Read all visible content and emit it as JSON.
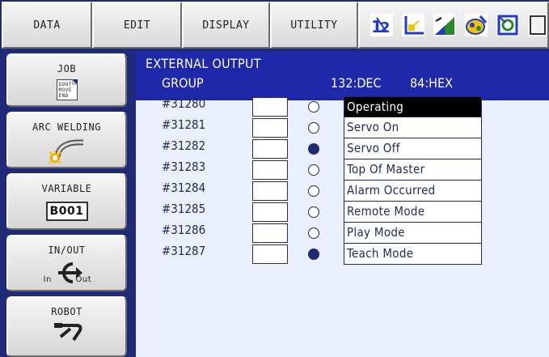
{
  "menu": {
    "items": [
      {
        "label": "DATA"
      },
      {
        "label": "EDIT"
      },
      {
        "label": "DISPLAY"
      },
      {
        "label": "UTILITY"
      }
    ],
    "status_icons": [
      "numeric-mode-icon",
      "coordinate-frame-icon",
      "speed-level-icon",
      "security-mode-icon",
      "play-mode-icon",
      "job-display-icon"
    ]
  },
  "sidebar": {
    "job_label": "JOB",
    "job_icon_text": "DOUT MOVE END",
    "arc_label": "ARC WELDING",
    "variable_label": "VARIABLE",
    "variable_value": "B001",
    "inout_label": "IN/OUT",
    "inout_in": "In",
    "inout_out": "Out",
    "robot_label": "ROBOT"
  },
  "panel": {
    "title": "EXTERNAL OUTPUT",
    "subtitle": "GROUP",
    "dec_label": "132:DEC",
    "hex_label": "84:HEX",
    "rows": [
      {
        "address": "#31280",
        "value": "",
        "state": "off",
        "name": "Operating",
        "selected": true
      },
      {
        "address": "#31281",
        "value": "",
        "state": "off",
        "name": "Servo On",
        "selected": false
      },
      {
        "address": "#31282",
        "value": "",
        "state": "on",
        "name": "Servo Off",
        "selected": false
      },
      {
        "address": "#31283",
        "value": "",
        "state": "off",
        "name": "Top Of Master",
        "selected": false
      },
      {
        "address": "#31284",
        "value": "",
        "state": "off",
        "name": "Alarm Occurred",
        "selected": false
      },
      {
        "address": "#31285",
        "value": "",
        "state": "off",
        "name": "Remote Mode",
        "selected": false
      },
      {
        "address": "#31286",
        "value": "",
        "state": "off",
        "name": "Play Mode",
        "selected": false
      },
      {
        "address": "#31287",
        "value": "",
        "state": "on",
        "name": "Teach Mode",
        "selected": false
      }
    ]
  },
  "colors": {
    "frame": "#1f2a78",
    "header": "#1e28a8",
    "panel": "#eaf0fb",
    "lamp_on": "#1e2a78"
  }
}
